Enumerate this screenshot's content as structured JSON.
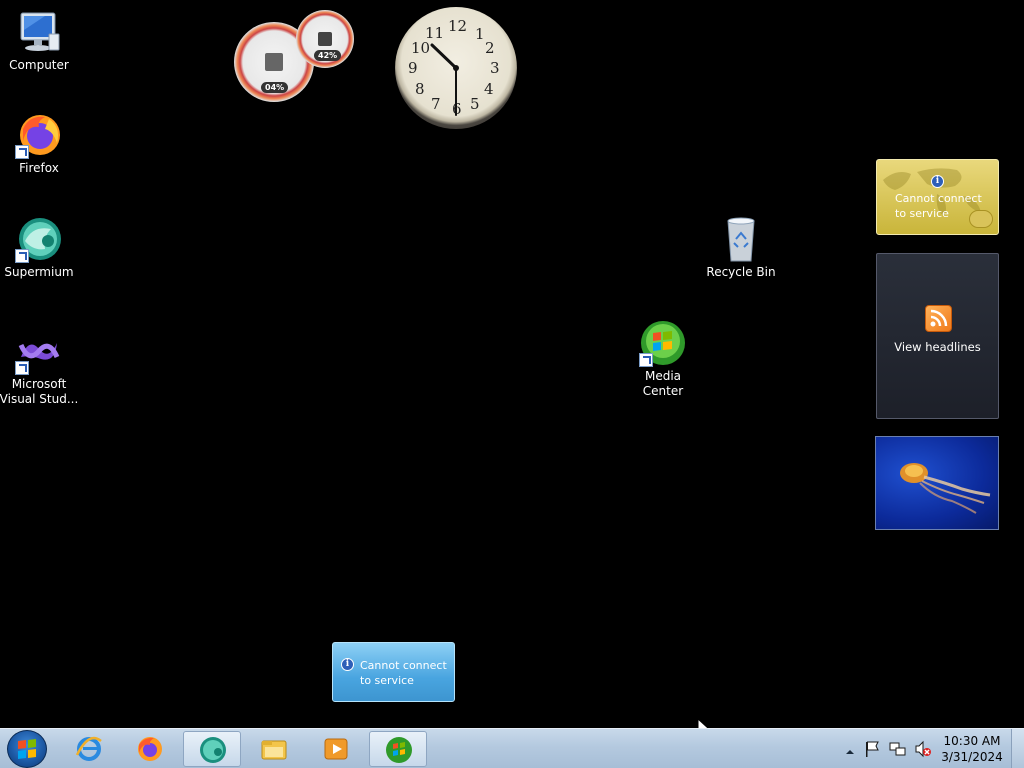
{
  "desktop_icons": {
    "computer": "Computer",
    "firefox": "Firefox",
    "supermium": "Supermium",
    "visual_studio_line1": "Microsoft",
    "visual_studio_line2": "Visual Stud...",
    "recycle_bin": "Recycle Bin",
    "media_center": "Media Center"
  },
  "gadgets": {
    "cpu_meter": {
      "cpu_percent": "04%",
      "memory_percent": "42%"
    },
    "clock": {
      "numerals": [
        "12",
        "1",
        "2",
        "3",
        "4",
        "5",
        "6",
        "7",
        "8",
        "9",
        "10",
        "11"
      ]
    },
    "weather": {
      "line1": "Cannot connect",
      "line2": "to service"
    },
    "feeds": {
      "label": "View headlines"
    },
    "currency": {
      "line1": "Cannot connect",
      "line2": "to service"
    }
  },
  "taskbar": {
    "apps": [
      "start-button",
      "internet-explorer",
      "firefox",
      "supermium",
      "windows-explorer",
      "windows-media-player",
      "windows-media-center"
    ],
    "clock_time": "10:30 AM",
    "clock_date": "3/31/2024"
  },
  "colors": {
    "desktop_background": "#000000",
    "taskbar": "#b4c9df",
    "weather_gadget": "#c9b53a",
    "currency_gadget": "#49a5e0"
  }
}
